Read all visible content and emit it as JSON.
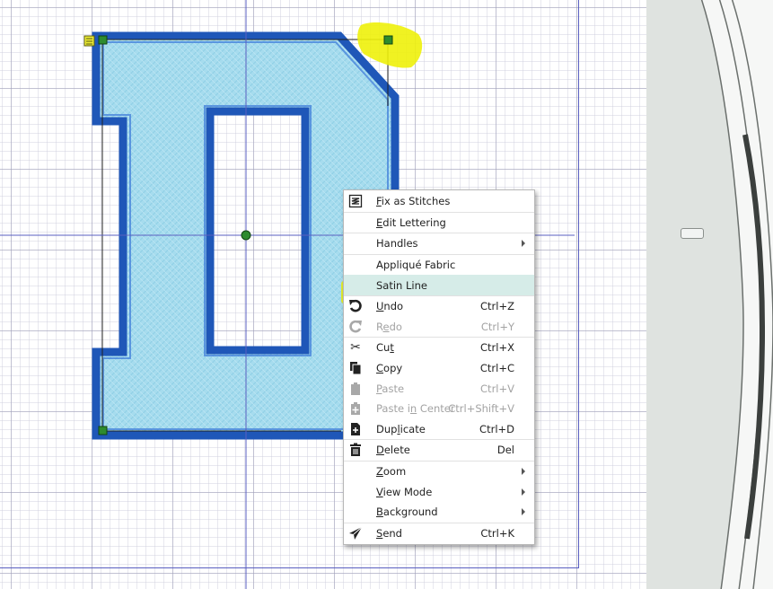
{
  "menu": {
    "items": [
      {
        "key": "fix_as_stitches",
        "label": "Fix as Stitches",
        "mnemonic": "F",
        "shortcut": "",
        "icon": "fix-stitches-icon",
        "has_submenu": false,
        "disabled": false
      },
      {
        "key": "edit_lettering",
        "label": "Edit Lettering",
        "mnemonic": "E",
        "shortcut": "",
        "icon": "",
        "has_submenu": false,
        "disabled": false
      },
      {
        "key": "handles",
        "label": "Handles",
        "mnemonic": "",
        "shortcut": "",
        "icon": "",
        "has_submenu": true,
        "disabled": false
      },
      {
        "key": "applique_fabric",
        "label": "Appliqué Fabric",
        "mnemonic": "",
        "shortcut": "",
        "icon": "",
        "has_submenu": false,
        "disabled": false
      },
      {
        "key": "satin_line",
        "label": "Satin Line",
        "mnemonic": "",
        "shortcut": "",
        "icon": "",
        "has_submenu": false,
        "disabled": false,
        "highlighted": true
      },
      {
        "key": "undo",
        "label": "Undo",
        "mnemonic": "U",
        "shortcut": "Ctrl+Z",
        "icon": "undo-icon",
        "has_submenu": false,
        "disabled": false
      },
      {
        "key": "redo",
        "label": "Redo",
        "mnemonic": "e",
        "shortcut": "Ctrl+Y",
        "icon": "redo-icon",
        "has_submenu": false,
        "disabled": true
      },
      {
        "key": "cut",
        "label": "Cut",
        "mnemonic": "t",
        "shortcut": "Ctrl+X",
        "icon": "scissors-icon",
        "has_submenu": false,
        "disabled": false
      },
      {
        "key": "copy",
        "label": "Copy",
        "mnemonic": "C",
        "shortcut": "Ctrl+C",
        "icon": "copy-icon",
        "has_submenu": false,
        "disabled": false
      },
      {
        "key": "paste",
        "label": "Paste",
        "mnemonic": "P",
        "shortcut": "Ctrl+V",
        "icon": "paste-icon",
        "has_submenu": false,
        "disabled": true
      },
      {
        "key": "paste_in_center",
        "label": "Paste in Center",
        "mnemonic": "n",
        "shortcut": "Ctrl+Shift+V",
        "icon": "paste-center-icon",
        "has_submenu": false,
        "disabled": true
      },
      {
        "key": "duplicate",
        "label": "Duplicate",
        "mnemonic": "l",
        "shortcut": "Ctrl+D",
        "icon": "duplicate-icon",
        "has_submenu": false,
        "disabled": false
      },
      {
        "key": "delete",
        "label": "Delete",
        "mnemonic": "D",
        "shortcut": "Del",
        "icon": "trash-icon",
        "has_submenu": false,
        "disabled": false
      },
      {
        "key": "zoom",
        "label": "Zoom",
        "mnemonic": "Z",
        "shortcut": "",
        "icon": "",
        "has_submenu": true,
        "disabled": false
      },
      {
        "key": "view_mode",
        "label": "View Mode",
        "mnemonic": "V",
        "shortcut": "",
        "icon": "",
        "has_submenu": true,
        "disabled": false
      },
      {
        "key": "background",
        "label": "Background",
        "mnemonic": "B",
        "shortcut": "",
        "icon": "",
        "has_submenu": true,
        "disabled": false
      },
      {
        "key": "send",
        "label": "Send",
        "mnemonic": "S",
        "shortcut": "Ctrl+K",
        "icon": "send-icon",
        "has_submenu": false,
        "disabled": false
      }
    ]
  },
  "design": {
    "letter": "D",
    "fill_color": "#a6dcee",
    "outline_color": "#1f57b8",
    "inner_outline_color": "#3a78d8",
    "handle_color": "#2e8b2e",
    "selection_line_color": "#222222",
    "highlight_marker_color": "#eef10a"
  },
  "colors": {
    "grid_major": "#a0a0b9",
    "grid_minor": "#cdcddc",
    "hoop_line": "#5a5fc0",
    "menu_highlight": "#d6ece8",
    "panel_bg": "#dfe3e0"
  }
}
